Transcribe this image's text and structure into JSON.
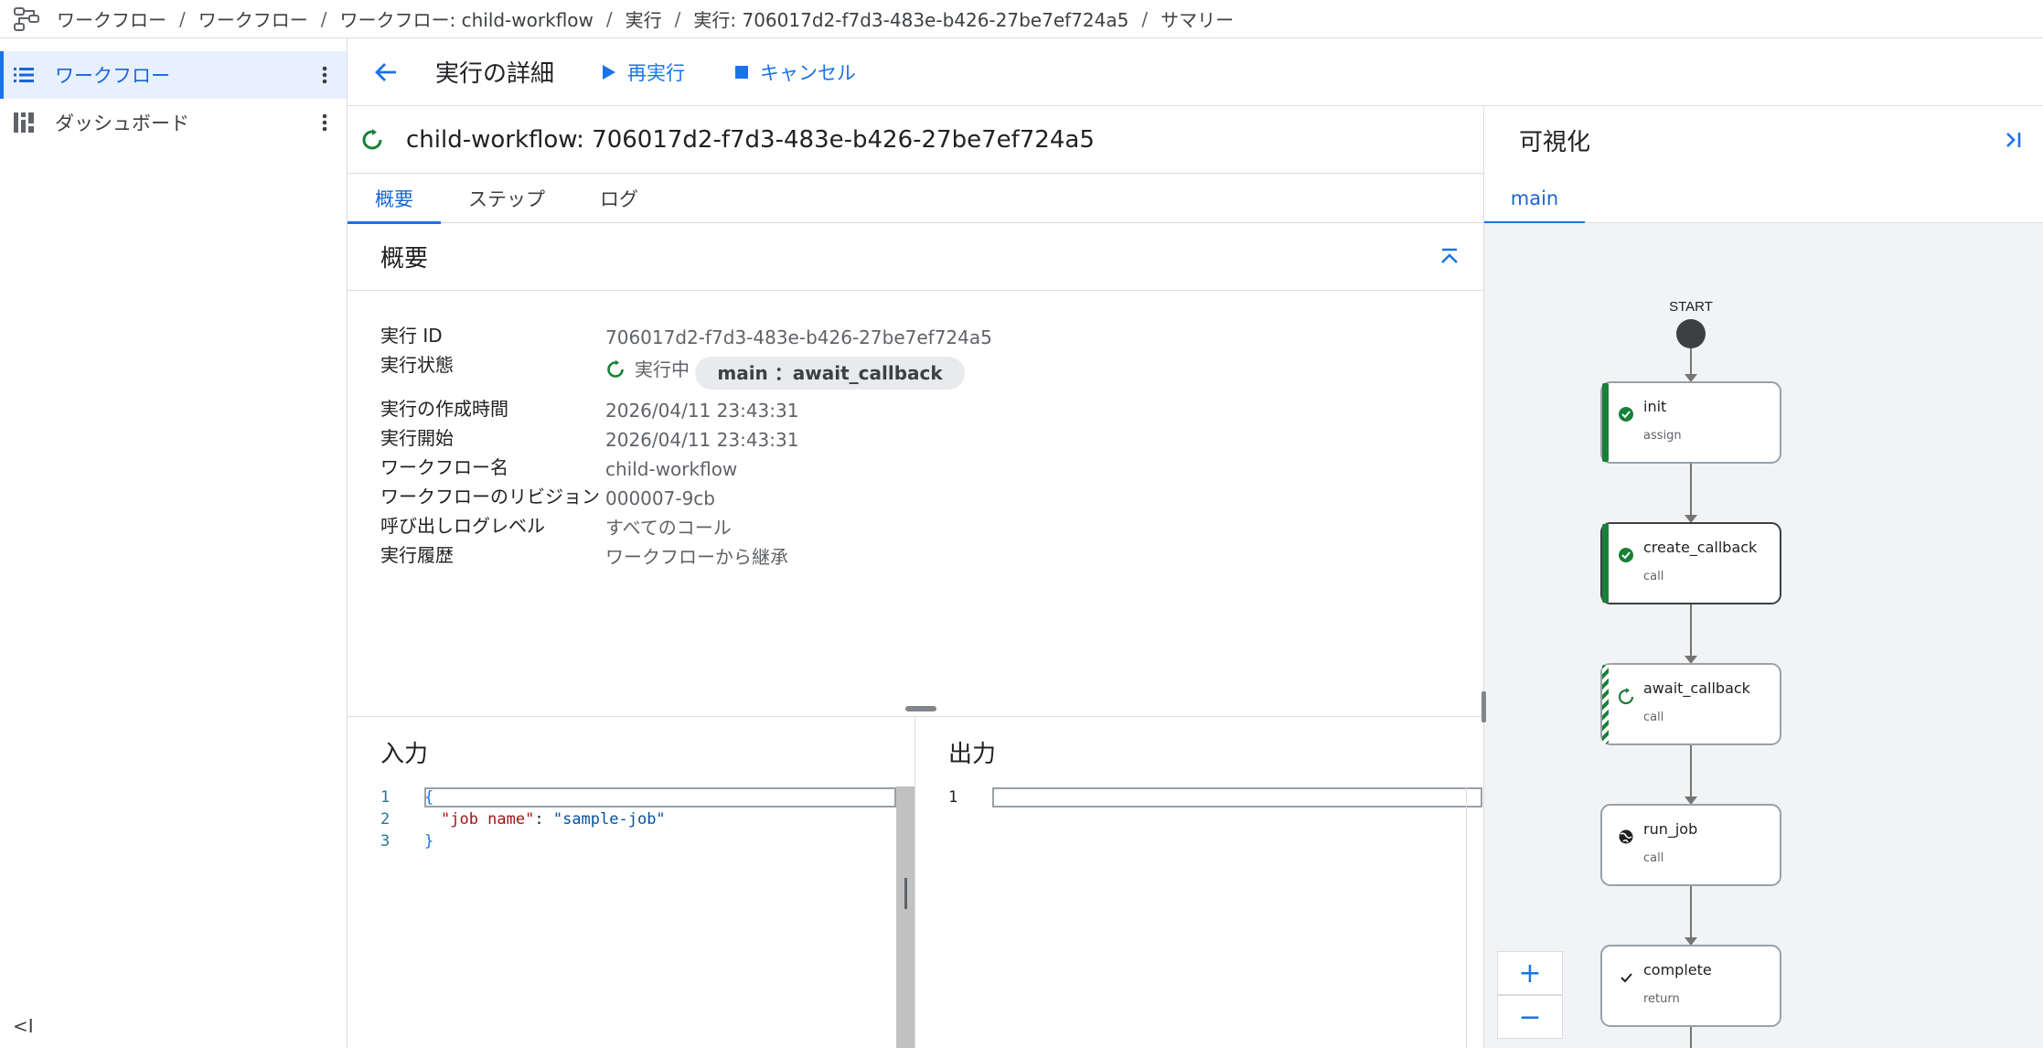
{
  "breadcrumb": {
    "items": [
      "ワークフロー",
      "ワークフロー",
      "ワークフロー: child-workflow",
      "実行",
      "実行: 706017d2-f7d3-483e-b426-27be7ef724a5",
      "サマリー"
    ],
    "separator": "/"
  },
  "sidebar": {
    "items": [
      {
        "label": "ワークフロー",
        "icon": "list-icon",
        "active": true
      },
      {
        "label": "ダッシュボード",
        "icon": "dashboard-icon",
        "active": false
      }
    ],
    "collapse_label": "<I"
  },
  "header": {
    "title": "実行の詳細",
    "rerun_label": "再実行",
    "cancel_label": "キャンセル"
  },
  "execution": {
    "title": "child-workflow: 706017d2-f7d3-483e-b426-27be7ef724a5"
  },
  "tabs": [
    "概要",
    "ステップ",
    "ログ"
  ],
  "summary": {
    "heading": "概要",
    "rows": {
      "execution_id": {
        "label": "実行 ID",
        "value": "706017d2-f7d3-483e-b426-27be7ef724a5"
      },
      "status": {
        "label": "実行状態",
        "value": "実行中",
        "chip": "main ：await_callback"
      },
      "created": {
        "label": "実行の作成時間",
        "value": "2026/04/11 23:43:31"
      },
      "started": {
        "label": "実行開始",
        "value": "2026/04/11 23:43:31"
      },
      "workflow_name": {
        "label": "ワークフロー名",
        "value": "child-workflow"
      },
      "revision": {
        "label": "ワークフローのリビジョン",
        "value": "000007-9cb"
      },
      "log_level": {
        "label": "呼び出しログレベル",
        "value": "すべてのコール"
      },
      "history": {
        "label": "実行履歴",
        "value": "ワークフローから継承"
      }
    }
  },
  "input": {
    "title": "入力",
    "line_numbers": [
      "1",
      "2",
      "3"
    ],
    "open_brace": "{",
    "key": "\"job name\"",
    "colon": ": ",
    "value": "\"sample-job\"",
    "close_brace": "}"
  },
  "output": {
    "title": "出力",
    "line_numbers": [
      "1"
    ]
  },
  "visualization": {
    "title": "可視化",
    "tab": "main",
    "start_label": "START",
    "nodes": [
      {
        "name": "init",
        "type": "assign",
        "state": "succeeded"
      },
      {
        "name": "create_callback",
        "type": "call",
        "state": "succeeded"
      },
      {
        "name": "await_callback",
        "type": "call",
        "state": "running"
      },
      {
        "name": "run_job",
        "type": "call",
        "state": "not-started"
      },
      {
        "name": "complete",
        "type": "return",
        "state": "not-started"
      }
    ],
    "zoom_in": "+",
    "zoom_out": "−"
  },
  "colors": {
    "accent": "#1a73e8",
    "success": "#188038",
    "node_border": "#9aa0a6"
  }
}
